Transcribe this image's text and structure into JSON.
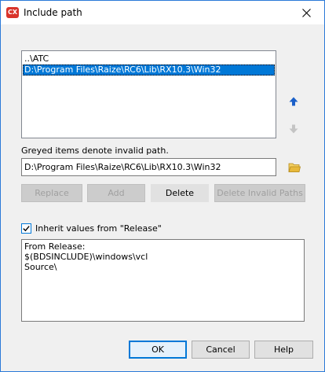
{
  "window": {
    "app_icon_text": "CX",
    "title": "Include path"
  },
  "paths": {
    "items": [
      {
        "label": "..\\ATC",
        "selected": false
      },
      {
        "label": "D:\\Program Files\\Raize\\RC6\\Lib\\RX10.3\\Win32",
        "selected": true
      }
    ]
  },
  "hint": "Greyed items denote invalid path.",
  "path_input": {
    "value": "D:\\Program Files\\Raize\\RC6\\Lib\\RX10.3\\Win32"
  },
  "actions": {
    "replace": "Replace",
    "add": "Add",
    "delete": "Delete",
    "delete_invalid": "Delete Invalid Paths"
  },
  "inherit": {
    "label": "Inherit values from \"Release\"",
    "checked": true
  },
  "inherited_values": {
    "lines": [
      "From Release:",
      "$(BDSINCLUDE)\\windows\\vcl",
      "Source\\"
    ]
  },
  "footer": {
    "ok": "OK",
    "cancel": "Cancel",
    "help": "Help"
  },
  "icons": {
    "app": "cx-app-icon",
    "close": "close-icon",
    "move_up": "arrow-up-icon",
    "move_down": "arrow-down-icon",
    "browse": "folder-icon",
    "check": "checkmark-icon"
  },
  "colors": {
    "selection": "#0078d7",
    "up_arrow": "#1a5fc8",
    "folder": "#e8b93b",
    "app_icon": "#d9342b"
  }
}
